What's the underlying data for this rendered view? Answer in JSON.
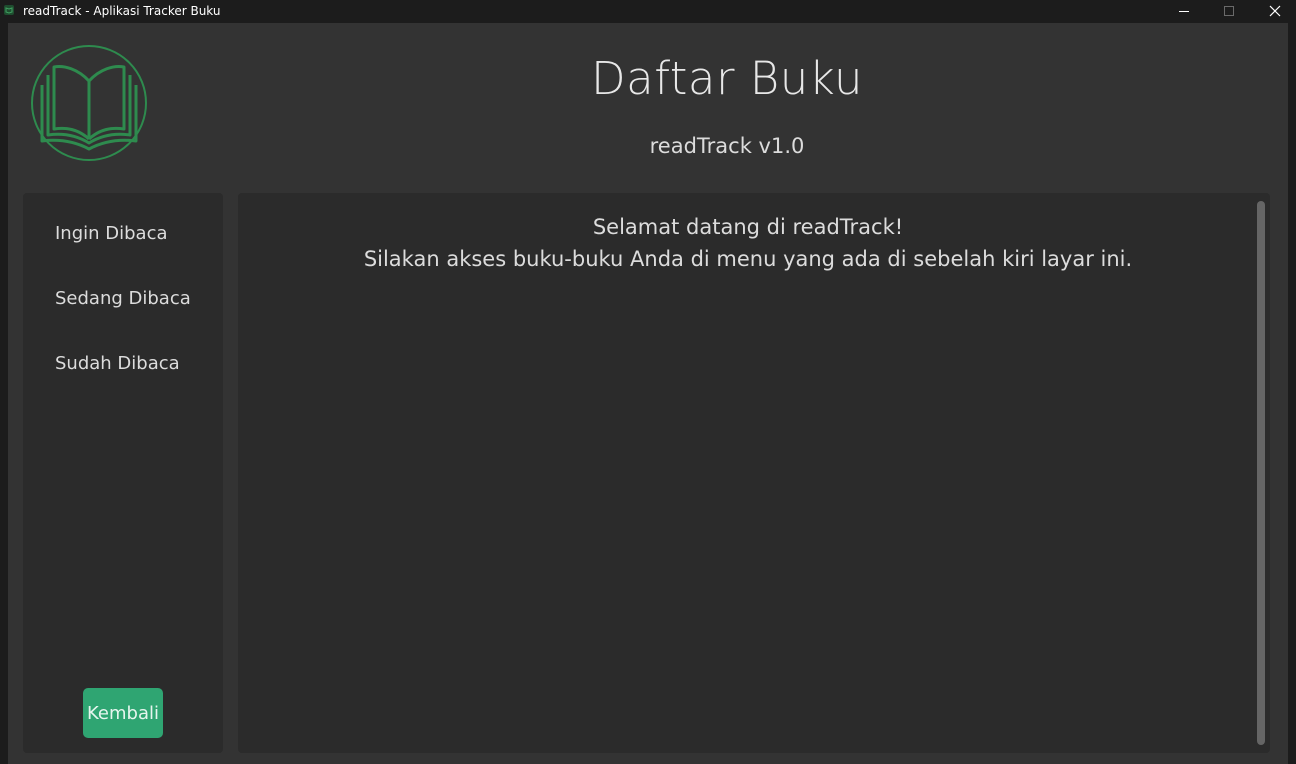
{
  "window": {
    "title": "readTrack - Aplikasi Tracker Buku",
    "icon": "book-app-icon",
    "controls": {
      "minimize_icon": "minimize-icon",
      "maximize_icon": "maximize-icon",
      "close_icon": "close-icon"
    }
  },
  "header": {
    "logo_icon": "open-book-icon",
    "title": "Daftar Buku",
    "subtitle": "readTrack v1.0"
  },
  "sidebar": {
    "items": [
      {
        "label": "Ingin Dibaca"
      },
      {
        "label": "Sedang Dibaca"
      },
      {
        "label": "Sudah Dibaca"
      }
    ],
    "back_label": "Kembali"
  },
  "main": {
    "welcome_line1": "Selamat datang di readTrack!",
    "welcome_line2": "Silakan akses buku-buku Anda di menu yang ada di sebelah kiri layar ini."
  },
  "colors": {
    "accent": "#2fa572",
    "logo": "#2e8b4e",
    "background": "#333333",
    "panel": "#2b2b2b"
  }
}
